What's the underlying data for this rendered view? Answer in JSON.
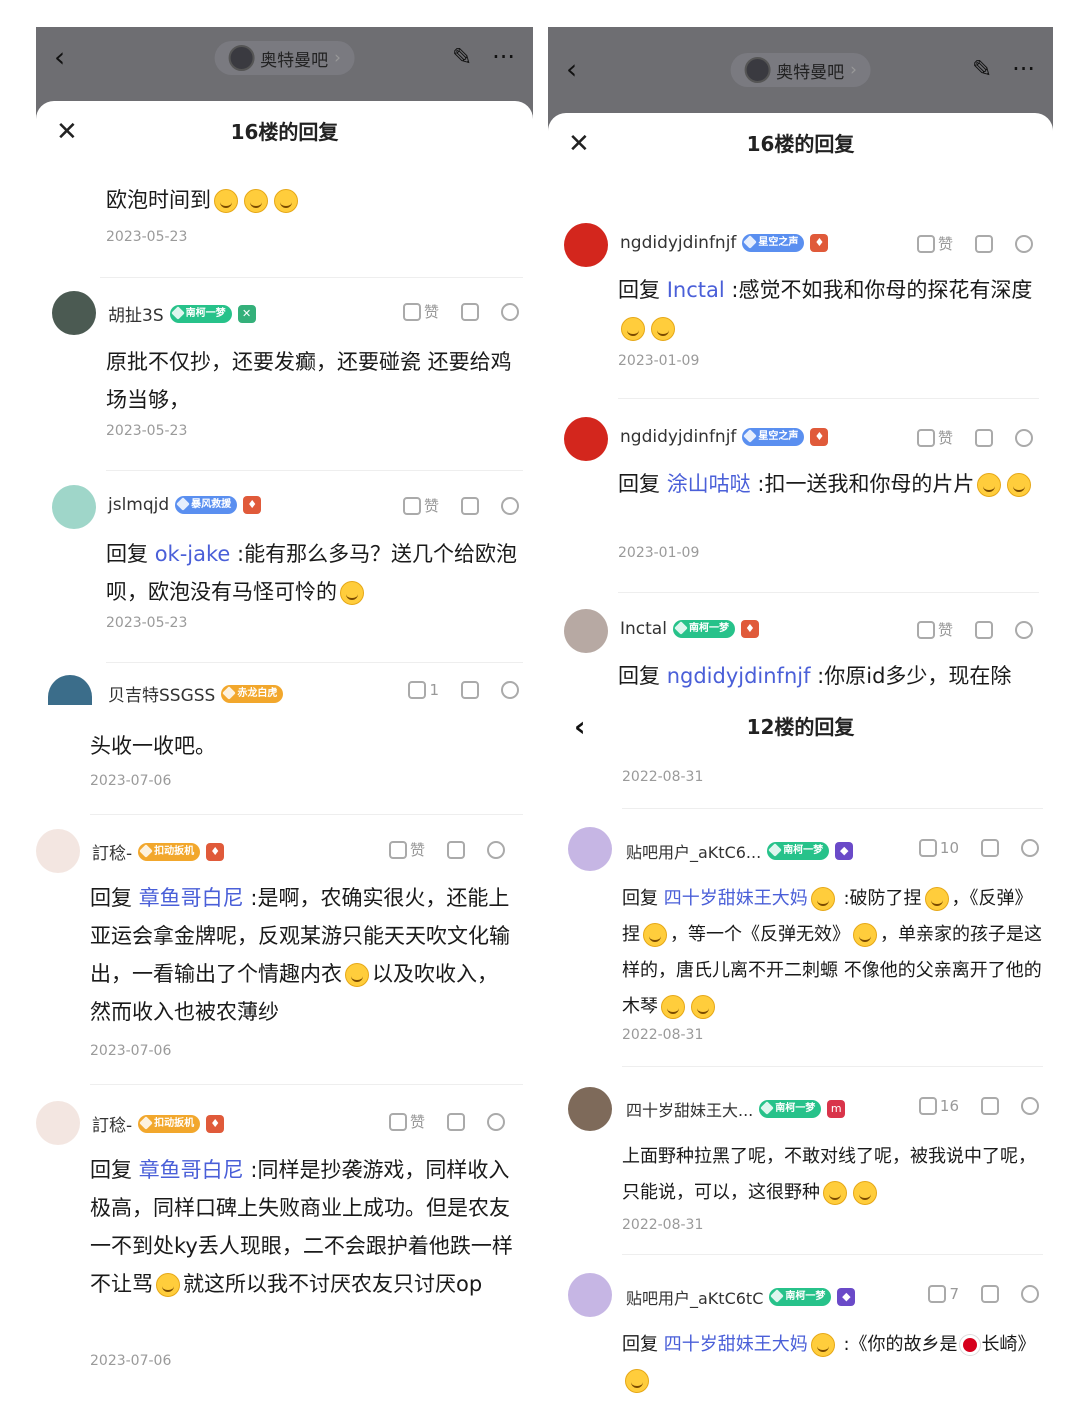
{
  "left": {
    "forum_name": "奥特曼吧",
    "sheet_title": "16楼的回复",
    "comments": [
      {
        "text": "欧泡时间到",
        "date": "2023-05-23"
      },
      {
        "name": "胡扯3S",
        "badge": "南柯一梦",
        "like": "赞",
        "text": "原批不仅抄，还要发癫，还要碰瓷 还要给鸡场当够，",
        "date": "2023-05-23"
      },
      {
        "name": "jslmqjd",
        "badge": "暴风救援",
        "like": "赞",
        "reply_prefix": "回复 ",
        "reply_to": "ok-jake",
        "text": " :能有那么多马？送几个给欧泡呗，欧泡没有马怪可怜的",
        "date": "2023-05-23"
      },
      {
        "name": "贝吉特SSGSS",
        "badge": "赤龙白虎",
        "like": "1"
      },
      {
        "text": "头收一收吧。",
        "date": "2023-07-06"
      },
      {
        "name": "訂稔-",
        "badge": "扣动扳机",
        "like": "赞",
        "reply_prefix": "回复 ",
        "reply_to": "章鱼哥白尼",
        "text": " :是啊，农确实很火，还能上亚运会拿金牌呢，反观某游只能天天吹文化输出，一看输出了个情趣内衣",
        "text2": "以及吹收入，然而收入也被农薄纱",
        "date": "2023-07-06"
      },
      {
        "name": "訂稔-",
        "badge": "扣动扳机",
        "like": "赞",
        "reply_prefix": "回复 ",
        "reply_to": "章鱼哥白尼",
        "text": " :同样是抄袭游戏，同样收入极高，同样口碑上失败商业上成功。但是农友一不到处ky丢人现眼，二不会跟护着他跌一样不让骂",
        "text2": "就这所以我不讨厌农友只讨厌op",
        "date": "2023-07-06"
      }
    ]
  },
  "right": {
    "forum_name": "奥特曼吧",
    "sheet_title": "16楼的回复",
    "sub_title": "12楼的回复",
    "comments": [
      {
        "name": "ngdidyjdinfnjf",
        "badge": "星空之声",
        "like": "赞",
        "reply_prefix": "回复 ",
        "reply_to": "Inctal",
        "text": " :感觉不如我和你母的探花有深度",
        "date": "2023-01-09"
      },
      {
        "name": "ngdidyjdinfnjf",
        "badge": "星空之声",
        "like": "赞",
        "reply_prefix": "回复 ",
        "reply_to": "涂山咕哒",
        "text": " :扣一送我和你母的片片",
        "date": "2023-01-09"
      },
      {
        "name": "Inctal",
        "badge": "南柯一梦",
        "like": "赞",
        "reply_prefix": "回复 ",
        "reply_to": "ngdidyjdinfnjf",
        "text": " :你原id多少，现在除"
      },
      {
        "date": "2022-08-31"
      },
      {
        "name": "贴吧用户_aKtC6...",
        "badge": "南柯一梦",
        "like": "10",
        "reply_prefix": "回复 ",
        "reply_to": "四十岁甜妹王大妈",
        "text": " :破防了捏",
        "text2": "，《反弹》捏",
        "text3": "，等一个《反弹无效》",
        "text4": "，单亲家的孩子是这样的，唐氏儿离不开二刺螈 不像他的父亲离开了他的木琴",
        "date": "2022-08-31"
      },
      {
        "name": "四十岁甜妹王大...",
        "badge": "南柯一梦",
        "like": "16",
        "text": "上面野种拉黑了呢，不敢对线了呢，被我说中了呢，只能说，可以，这很野种",
        "date": "2022-08-31"
      },
      {
        "name": "贴吧用户_aKtC6tC",
        "badge": "南柯一梦",
        "like": "7",
        "reply_prefix": "回复 ",
        "reply_to": "四十岁甜妹王大妈",
        "text": " :《你的故乡是",
        "text2": "长崎》"
      }
    ]
  },
  "colors": {
    "link": "#4a5fd8",
    "topbar": "#6e6e72",
    "badge_green": "#27c28a",
    "badge_blue": "#5a8ff0",
    "badge_orange": "#f2a72c"
  }
}
